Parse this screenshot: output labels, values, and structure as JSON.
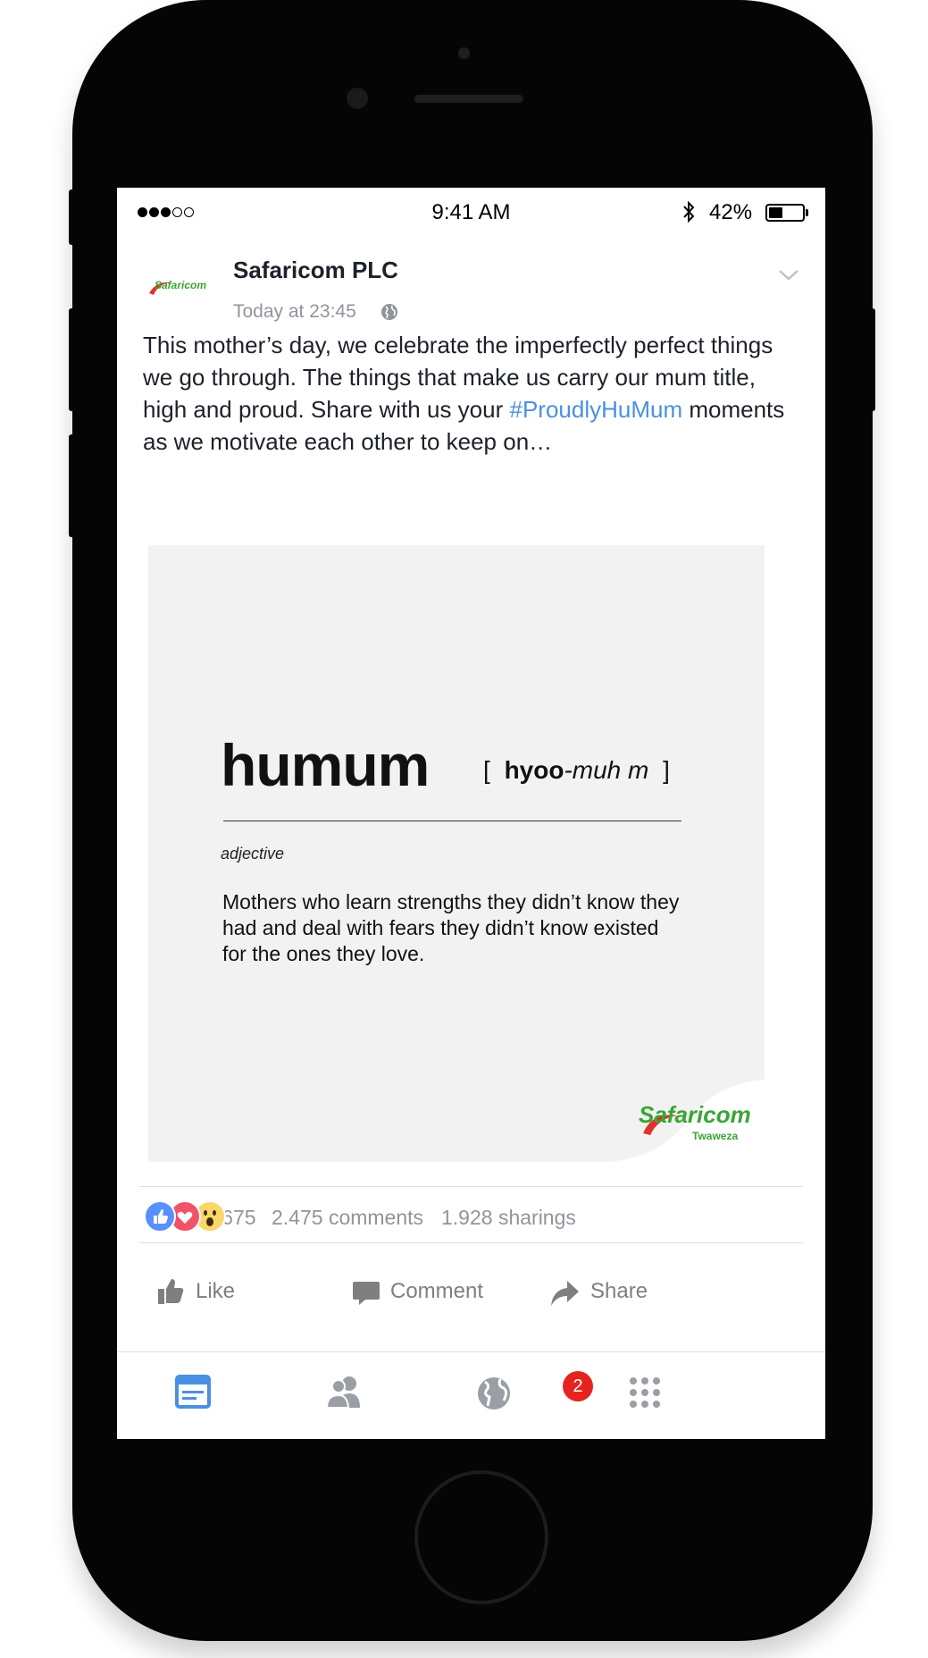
{
  "status_bar": {
    "time": "9:41 AM",
    "battery_percent": "42%",
    "battery_level": 0.42,
    "signal_strength": 3
  },
  "post": {
    "author": "Safaricom PLC",
    "timestamp": "Today at 23:45",
    "text_before": "This mother’s day, we celebrate the imperfectly perfect things we go through. The things that make us carry our mum title, high and proud. Share with us your ",
    "hashtag": "#ProudlyHuMum",
    "text_after": " moments as we motivate each other to keep on…",
    "avatar_logo_text": "Safaricom"
  },
  "media": {
    "word": "humum",
    "pronunciation_open": "[",
    "pronunciation_bold": "hyoo",
    "pronunciation_rest": "-muh m",
    "pronunciation_close": "]",
    "part_of_speech": "adjective",
    "definition": "Mothers who learn strengths they didn’t know they had and deal with fears they didn’t know existed for the ones they love.",
    "brand_name": "Safaricom",
    "brand_tagline": "Twaweza"
  },
  "stats": {
    "reactions_count": "3.675",
    "comments": "2.475 comments",
    "shares": "1.928 sharings"
  },
  "actions": {
    "like": "Like",
    "comment": "Comment",
    "share": "Share"
  },
  "tabbar": {
    "notifications_badge": "2"
  },
  "colors": {
    "hashtag": "#4a90e2",
    "brand_green": "#3aa535",
    "brand_red": "#e4312b",
    "like_blue": "#5890ff",
    "love_red": "#f25268",
    "wow_yellow": "#fcd669",
    "tab_active": "#4a90e2",
    "tab_inactive": "#9a9ea5",
    "badge": "#e52420"
  },
  "icons": [
    "signal-dots-icon",
    "bluetooth-icon",
    "battery-icon",
    "globe-icon",
    "chevron-down-icon",
    "like-reaction-icon",
    "love-reaction-icon",
    "wow-reaction-icon",
    "thumbs-up-icon",
    "comment-icon",
    "share-arrow-icon",
    "news-feed-icon",
    "friends-icon",
    "notifications-globe-icon",
    "menu-grid-icon"
  ]
}
